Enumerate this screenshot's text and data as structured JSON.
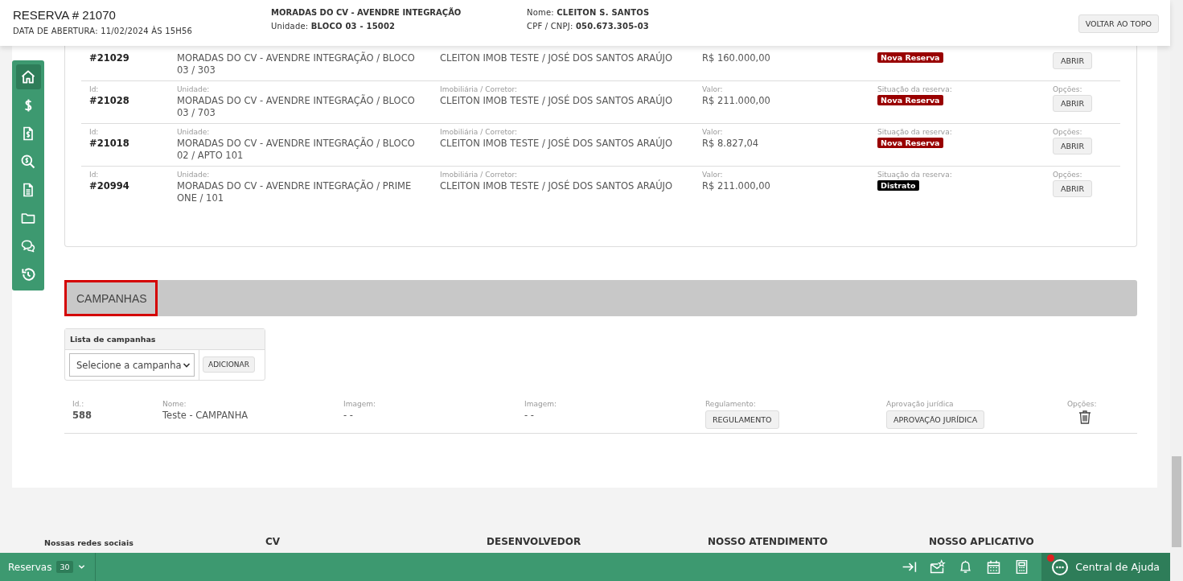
{
  "header": {
    "title": "RESERVA # 21070",
    "opened": "DATA DE ABERTURA: 11/02/2024 ÀS 15H56",
    "project": "MORADAS DO CV - AVENDRE INTEGRAÇÃO",
    "unit_label": "Unidade:",
    "unit_value": "BLOCO 03 - 15002",
    "name_label": "Nome:",
    "name_value": "CLEITON S. SANTOS",
    "doc_label": "CPF / CNPJ:",
    "doc_value": "050.673.305-03",
    "back_button": "VOLTAR AO TOPO"
  },
  "sidebar": {
    "items": [
      {
        "kind": "home",
        "selected": true
      },
      {
        "kind": "dollar",
        "selected": false
      },
      {
        "kind": "invoice",
        "selected": false
      },
      {
        "kind": "money-search",
        "selected": false
      },
      {
        "kind": "document",
        "selected": false
      },
      {
        "kind": "folder",
        "selected": false
      },
      {
        "kind": "chat",
        "selected": false
      },
      {
        "kind": "history",
        "selected": false
      }
    ]
  },
  "reservations": {
    "rows": [
      {
        "id": "#21029",
        "unit": "MORADAS DO CV - AVENDRE INTEGRAÇÃO / BLOCO 03 / 303",
        "broker": "CLEITON IMOB TESTE / JOSÉ DOS SANTOS ARAÚJO",
        "value": "R$ 160.000,00",
        "status": {
          "text": "Nova Reserva",
          "kind": "new"
        },
        "button": "ABRIR"
      },
      {
        "labels": {
          "id": "Id:",
          "unit": "Unidade:",
          "broker": "Imobiliária / Corretor:",
          "value": "Valor:",
          "status": "Situação da reserva:",
          "options": "Opções:"
        },
        "id": "#21028",
        "unit": "MORADAS DO CV - AVENDRE INTEGRAÇÃO / BLOCO 03 / 703",
        "broker": "CLEITON IMOB TESTE / JOSÉ DOS SANTOS ARAÚJO",
        "value": "R$ 211.000,00",
        "status": {
          "text": "Nova Reserva",
          "kind": "new"
        },
        "button": "ABRIR"
      },
      {
        "labels": {
          "id": "Id:",
          "unit": "Unidade:",
          "broker": "Imobiliária / Corretor:",
          "value": "Valor:",
          "status": "Situação da reserva:",
          "options": "Opções:"
        },
        "id": "#21018",
        "unit": "MORADAS DO CV - AVENDRE INTEGRAÇÃO / BLOCO 02 / APTO 101",
        "broker": "CLEITON IMOB TESTE / JOSÉ DOS SANTOS ARAÚJO",
        "value": "R$ 8.827,04",
        "status": {
          "text": "Nova Reserva",
          "kind": "new"
        },
        "button": "ABRIR"
      },
      {
        "labels": {
          "id": "Id:",
          "unit": "Unidade:",
          "broker": "Imobiliária / Corretor:",
          "value": "Valor:",
          "status": "Situação da reserva:",
          "options": "Opções:"
        },
        "id": "#20994",
        "unit": "MORADAS DO CV - AVENDRE INTEGRAÇÃO / PRIME ONE / 101",
        "broker": "CLEITON IMOB TESTE / JOSÉ DOS SANTOS ARAÚJO",
        "value": "R$ 211.000,00",
        "status": {
          "text": "Distrato",
          "kind": "cancelled"
        },
        "button": "ABRIR"
      }
    ]
  },
  "campaigns": {
    "title": "CAMPANHAS",
    "list_title": "Lista de campanhas",
    "select_placeholder": "Selecione a campanha",
    "add_button": "ADICIONAR",
    "rows": [
      {
        "id_label": "Id.:",
        "id": "588",
        "name_label": "Nome:",
        "name": "Teste - CAMPANHA",
        "image_label": "Imagem:",
        "image": "- -",
        "image2_label": "Imagem:",
        "image2": "- -",
        "regulation_label": "Regulamento:",
        "regulation_button": "REGULAMENTO",
        "approval_label": "Aprovação jurídica",
        "approval_button": "APROVAÇÃO JURÍDICA",
        "options_label": "Opções:"
      }
    ]
  },
  "footer": {
    "headings": [
      "Nossas redes sociais",
      "CV",
      "DESENVOLVEDOR",
      "NOSSO ATENDIMENTO",
      "NOSSO APLICATIVO"
    ]
  },
  "bottom_bar": {
    "module": "Reservas",
    "count": "30",
    "tools": [
      {
        "kind": "collapse"
      },
      {
        "kind": "mail"
      },
      {
        "kind": "bell"
      },
      {
        "kind": "calendar"
      },
      {
        "kind": "calculator"
      }
    ],
    "help": "Central de Ajuda"
  }
}
